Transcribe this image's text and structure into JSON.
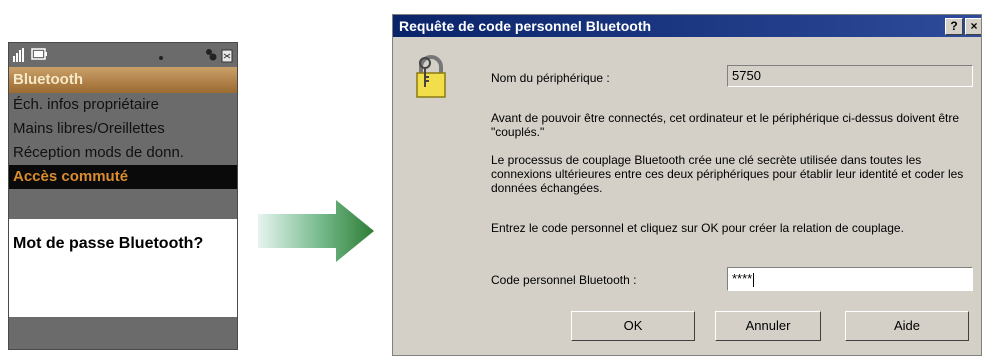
{
  "phone": {
    "title": "Bluetooth",
    "menu_items": [
      "Éch. infos propriétaire",
      "Mains libres/Oreillettes",
      "Réception mods de donn.",
      "Accès commuté"
    ],
    "prompt": "Mot de passe Bluetooth?",
    "icons": [
      "signal-icon",
      "battery-icon",
      "bluetooth-status-icon",
      "lock-status-icon"
    ],
    "colors": {
      "title_bg": "#b98443",
      "selected_bg": "#0a0a0a",
      "selected_text": "#d98b2f"
    }
  },
  "arrow": {
    "color": "#3f8f3f"
  },
  "dialog": {
    "title": "Requête de code personnel Bluetooth",
    "title_buttons": {
      "help": "?",
      "close": "×"
    },
    "device_label": "Nom du périphérique :",
    "device_value": "5750",
    "para1": "Avant de pouvoir être connectés, cet ordinateur et le périphérique ci-dessus doivent être \"couplés.\"",
    "para2": "Le processus de couplage Bluetooth crée une clé secrète utilisée dans toutes les connexions ultérieures entre ces deux périphériques pour établir leur identité et coder les données échangées.",
    "para3": "Entrez le code personnel et cliquez sur OK pour créer la relation de couplage.",
    "pin_label": "Code personnel Bluetooth :",
    "pin_value": "****",
    "buttons": {
      "ok": "OK",
      "cancel": "Annuler",
      "help": "Aide"
    },
    "colors": {
      "title_bg": "#0a246a",
      "face": "#d4d0c8"
    }
  }
}
